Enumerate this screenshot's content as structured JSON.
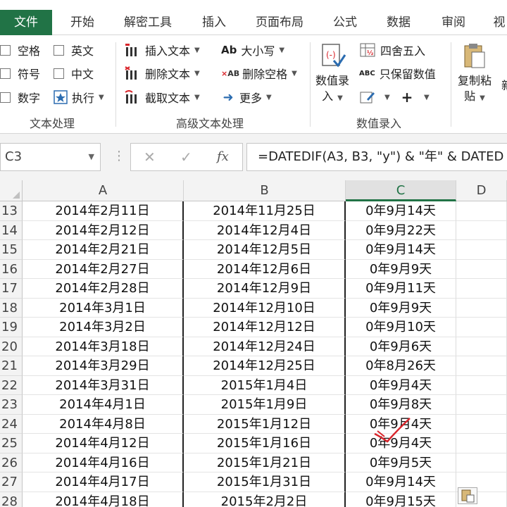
{
  "tabs": [
    {
      "label": "文件",
      "active": true
    },
    {
      "label": "开始"
    },
    {
      "label": "解密工具"
    },
    {
      "label": "插入"
    },
    {
      "label": "页面布局"
    },
    {
      "label": "公式"
    },
    {
      "label": "数据"
    },
    {
      "label": "审阅"
    },
    {
      "label": "视"
    }
  ],
  "ribbon": {
    "text_processing": {
      "checkboxes": [
        "空格",
        "英文",
        "符号",
        "中文",
        "数字"
      ],
      "exec_label": "执行",
      "group_label": "文本处理"
    },
    "advanced_text": {
      "insert_text": "插入文本",
      "delete_text": "删除文本",
      "extract_text": "截取文本",
      "case": "大小写",
      "delete_spaces": "删除空格",
      "more": "更多",
      "group_label": "高级文本处理",
      "case_icon_text": "Ab",
      "delspace_icon_text": "AB"
    },
    "data_entry": {
      "data_entry_btn_line1": "数值录",
      "data_entry_btn_line2": "入",
      "round": "四舍五入",
      "keep_values": "只保留数值",
      "keep_icon_text": "ABC",
      "group_label": "数值录入"
    },
    "clipboard": {
      "copy_paste_line1": "复制粘",
      "copy_paste_line2": "贴",
      "next_partial": "新"
    }
  },
  "formula_bar": {
    "name_box": "C3",
    "formula": "=DATEDIF(A3, B3, \"y\") & \"年\" & DATED",
    "fx": "fx"
  },
  "sheet": {
    "columns": [
      "A",
      "B",
      "C",
      "D"
    ],
    "selected_column": "C",
    "rows": [
      {
        "num": "13",
        "a": "2014年2月11日",
        "b": "2014年11月25日",
        "c": "0年9月14天"
      },
      {
        "num": "14",
        "a": "2014年2月12日",
        "b": "2014年12月4日",
        "c": "0年9月22天"
      },
      {
        "num": "15",
        "a": "2014年2月21日",
        "b": "2014年12月5日",
        "c": "0年9月14天"
      },
      {
        "num": "16",
        "a": "2014年2月27日",
        "b": "2014年12月6日",
        "c": "0年9月9天"
      },
      {
        "num": "17",
        "a": "2014年2月28日",
        "b": "2014年12月9日",
        "c": "0年9月11天"
      },
      {
        "num": "18",
        "a": "2014年3月1日",
        "b": "2014年12月10日",
        "c": "0年9月9天"
      },
      {
        "num": "19",
        "a": "2014年3月2日",
        "b": "2014年12月12日",
        "c": "0年9月10天"
      },
      {
        "num": "20",
        "a": "2014年3月18日",
        "b": "2014年12月24日",
        "c": "0年9月6天"
      },
      {
        "num": "21",
        "a": "2014年3月29日",
        "b": "2014年12月25日",
        "c": "0年8月26天"
      },
      {
        "num": "22",
        "a": "2014年3月31日",
        "b": "2015年1月4日",
        "c": "0年9月4天"
      },
      {
        "num": "23",
        "a": "2014年4月1日",
        "b": "2015年1月9日",
        "c": "0年9月8天"
      },
      {
        "num": "24",
        "a": "2014年4月8日",
        "b": "2015年1月12日",
        "c": "0年9月4天"
      },
      {
        "num": "25",
        "a": "2014年4月12日",
        "b": "2015年1月16日",
        "c": "0年9月4天"
      },
      {
        "num": "26",
        "a": "2014年4月16日",
        "b": "2015年1月21日",
        "c": "0年9月5天"
      },
      {
        "num": "27",
        "a": "2014年4月17日",
        "b": "2015年1月31日",
        "c": "0年9月14天"
      },
      {
        "num": "28",
        "a": "2014年4月18日",
        "b": "2015年2月2日",
        "c": "0年9月15天"
      }
    ]
  },
  "colors": {
    "accent": "#217346",
    "annotation": "#d9262c"
  }
}
